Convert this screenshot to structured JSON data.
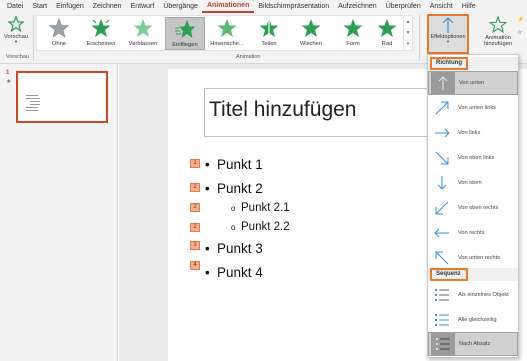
{
  "menu": [
    "Datei",
    "Start",
    "Einfügen",
    "Zeichnen",
    "Entwurf",
    "Übergänge",
    "Animationen",
    "Bildschirmpräsentation",
    "Aufzeichnen",
    "Überprüfen",
    "Ansicht",
    "Hilfe"
  ],
  "menu_active": "Animationen",
  "ribbon": {
    "preview_label": "Vorschau",
    "preview_group": "Vorschau",
    "animations": [
      "Ohne",
      "Erscheinen",
      "Verblassen",
      "Einfliegen",
      "Hineinsche...",
      "Teilen",
      "Wischen",
      "Form",
      "Rad"
    ],
    "selected_animation": "Einfliegen",
    "animation_group": "Animation",
    "effect_options_label": "Effektoptionen",
    "add_animation_line1": "Animation",
    "add_animation_line2": "hinzufügen"
  },
  "thumbnail": {
    "slide_number": "1",
    "star": "★"
  },
  "slide": {
    "title_placeholder": "Titel hinzufügen",
    "bullets": [
      {
        "tag": "1",
        "text": "Punkt 1",
        "level": 1
      },
      {
        "tag": "2",
        "text": "Punkt 2",
        "level": 1
      },
      {
        "tag": "2",
        "text": "Punkt 2.1",
        "level": 2
      },
      {
        "tag": "2",
        "text": "Punkt 2.2",
        "level": 2
      },
      {
        "tag": "3",
        "text": "Punkt 3",
        "level": 1
      },
      {
        "tag": "4",
        "text": "Punkt 4",
        "level": 1
      }
    ]
  },
  "dropdown": {
    "direction_heading": "Richtung",
    "directions": [
      "Von unten",
      "Von unten links",
      "Von links",
      "Von oben links",
      "Von oben",
      "Von oben rechts",
      "Von rechts",
      "Von unten rechts"
    ],
    "selected_direction": "Von unten",
    "sequence_heading": "Sequenz",
    "sequences": [
      "Als einzelnes Objekt",
      "Alle gleichzeitig",
      "Nach Absatz"
    ],
    "selected_sequence": "Nach Absatz"
  },
  "colors": {
    "accent": "#b7472a",
    "highlight": "#e8782a",
    "icon_blue": "#3b8fd6",
    "icon_green": "#2e9e55"
  }
}
